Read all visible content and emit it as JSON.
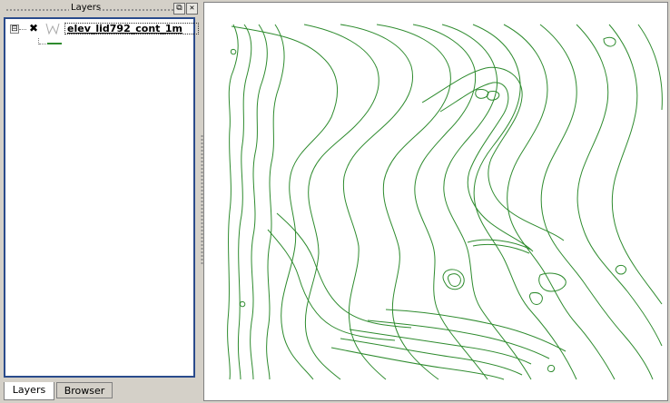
{
  "layers_panel": {
    "title": "Layers",
    "float_icon": "float-window-icon",
    "close_icon": "close-icon",
    "expander_symbol": "⊟",
    "checkbox_symbol": "✖",
    "layer_type_icon": "vector-line-icon",
    "layer_name": "elev_lid792_cont_1m"
  },
  "tabs": {
    "layers": "Layers",
    "browser": "Browser"
  },
  "map": {
    "layer": "elev_lid792_cont_1m",
    "contour_color": "#2e8b2e",
    "background": "#ffffff"
  },
  "colors": {
    "panel_border": "#2a4b8c",
    "dock_bg": "#d4d0c8"
  }
}
